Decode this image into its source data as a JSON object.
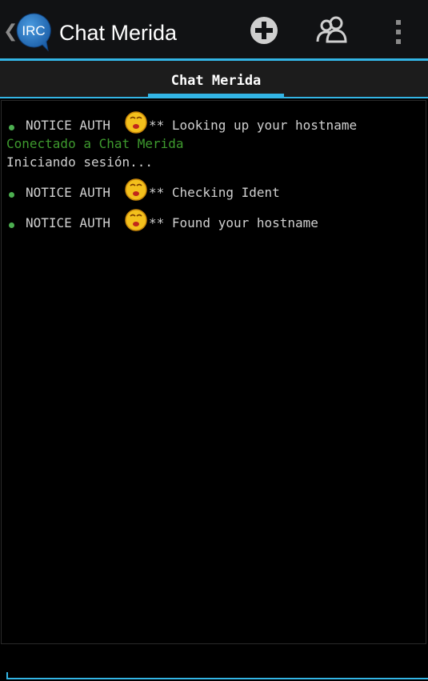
{
  "action_bar": {
    "up_glyph": "❮",
    "logo_text": "IRC",
    "title": "Chat Merida",
    "actions": [
      {
        "name": "add-icon"
      },
      {
        "name": "users-icon"
      },
      {
        "name": "overflow-menu-icon"
      }
    ],
    "accent_color": "#33b5e5"
  },
  "tabs": [
    {
      "label": "Chat Merida",
      "selected": true
    }
  ],
  "messages": [
    {
      "type": "notice",
      "prefix": "NOTICE AUTH",
      "icon": "emoji-kiss-icon",
      "text": "** Looking up your hostname"
    },
    {
      "type": "status",
      "text": "Conectado a Chat Merida",
      "color": "#3e9a2e"
    },
    {
      "type": "plain",
      "text": "Iniciando sesión..."
    },
    {
      "type": "notice",
      "prefix": "NOTICE AUTH",
      "icon": "emoji-kiss-icon",
      "text": "** Checking Ident"
    },
    {
      "type": "notice",
      "prefix": "NOTICE AUTH",
      "icon": "emoji-kiss-icon",
      "text": "** Found your hostname"
    }
  ],
  "input": {
    "value": "",
    "placeholder": ""
  }
}
